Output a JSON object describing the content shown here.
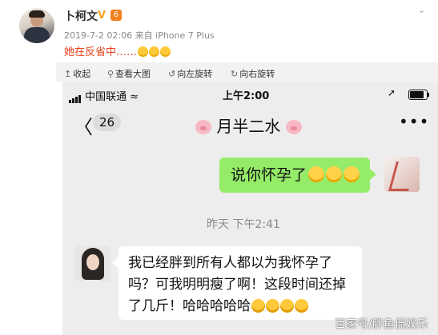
{
  "post": {
    "author": "卜柯文",
    "verified_badge": "V",
    "level_badge": "6",
    "timestamp": "2019-7-2 02:06",
    "source": "来自 iPhone 7 Plus",
    "text": "她在反省中……",
    "text_emojis": [
      "laugh-cry-emoji",
      "laugh-cry-emoji",
      "laugh-cry-emoji"
    ],
    "menu_icon": "chevron-down-icon"
  },
  "toolbar": {
    "collapse_label": "收起",
    "view_large_label": "查看大图",
    "rotate_left_label": "向左旋转",
    "rotate_right_label": "向右旋转"
  },
  "chat_screenshot": {
    "status_bar": {
      "carrier": "中国联通",
      "time": "上午2:00"
    },
    "nav": {
      "back_symbol": "〈",
      "unread_count": "26",
      "contact_name": "月半二水",
      "more_symbol": "•••"
    },
    "messages": [
      {
        "direction": "outgoing",
        "text": "说你怀孕了",
        "emojis": [
          "sweat-emoji",
          "sweat-emoji",
          "sweat-emoji"
        ]
      },
      {
        "type": "timestamp",
        "text": "昨天 下午2:41"
      },
      {
        "direction": "incoming",
        "text": "我已经胖到所有人都以为我怀孕了吗？可我明明瘦了啊！这段时间还掉了几斤！哈哈哈哈哈",
        "emojis": [
          "laugh-cry-emoji",
          "laugh-cry-emoji",
          "laugh-cry-emoji",
          "laugh-cry-emoji"
        ]
      }
    ]
  },
  "watermark": "百家号/胖鱼侃娱乐",
  "colors": {
    "outgoing_bubble": "#95ec69",
    "chat_background": "#ededed",
    "post_text": "#e5401a",
    "verified": "#f5a623"
  }
}
